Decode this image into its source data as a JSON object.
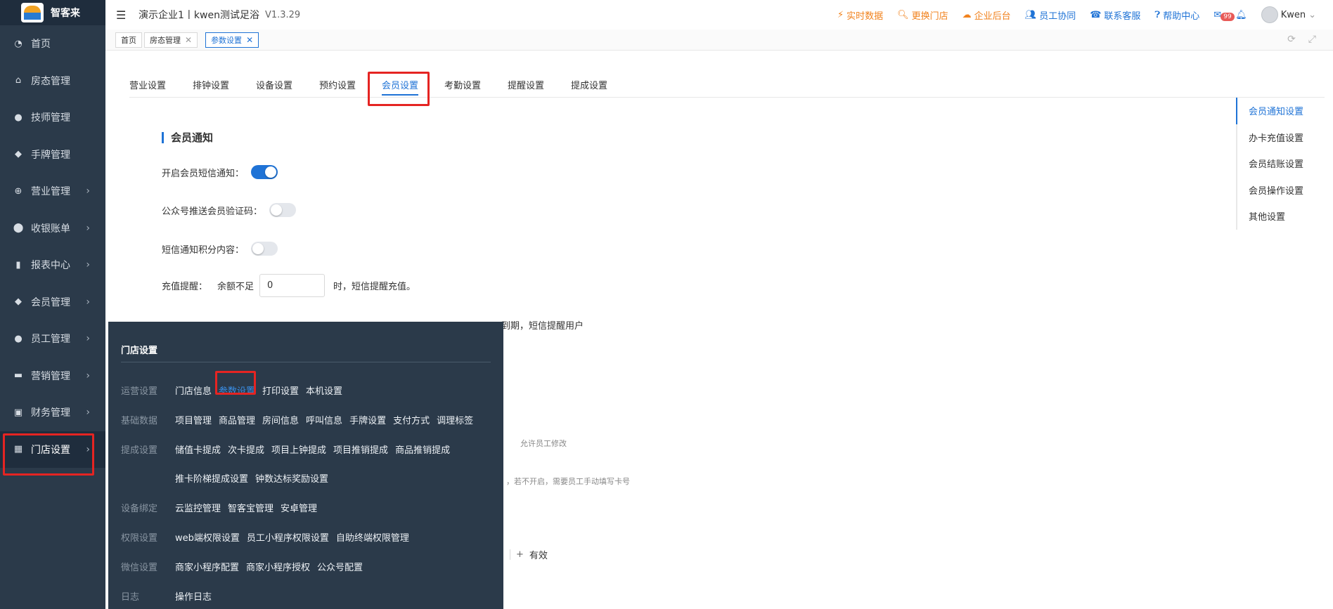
{
  "app": {
    "name": "智客来"
  },
  "sidebar": {
    "items": [
      {
        "label": "首页",
        "icon": "dashboard-icon",
        "has_children": false
      },
      {
        "label": "房态管理",
        "icon": "home-icon",
        "has_children": false
      },
      {
        "label": "技师管理",
        "icon": "user-icon",
        "has_children": false
      },
      {
        "label": "手牌管理",
        "icon": "tag-icon",
        "has_children": false
      },
      {
        "label": "营业管理",
        "icon": "target-icon",
        "has_children": true
      },
      {
        "label": "收银账单",
        "icon": "moneybag-icon",
        "has_children": true
      },
      {
        "label": "报表中心",
        "icon": "bar-chart-icon",
        "has_children": true
      },
      {
        "label": "会员管理",
        "icon": "diamond-icon",
        "has_children": true
      },
      {
        "label": "员工管理",
        "icon": "user-icon",
        "has_children": true
      },
      {
        "label": "营销管理",
        "icon": "briefcase-icon",
        "has_children": true
      },
      {
        "label": "财务管理",
        "icon": "wallet-icon",
        "has_children": true
      },
      {
        "label": "门店设置",
        "icon": "grid-icon",
        "has_children": true,
        "active": true
      }
    ]
  },
  "header": {
    "company": "演示企业1丨kwen测试足浴",
    "version": "V1.3.29",
    "links": [
      {
        "label": "实时数据",
        "icon": "trend-icon",
        "color": "#f1821d"
      },
      {
        "label": "更换门店",
        "icon": "search-icon",
        "color": "#f1821d"
      },
      {
        "label": "企业后台",
        "icon": "cloud-icon",
        "color": "#f1821d"
      },
      {
        "label": "员工协同",
        "icon": "users-icon",
        "color": "#1f73d6"
      },
      {
        "label": "联系客服",
        "icon": "phone-icon",
        "color": "#1f73d6"
      },
      {
        "label": "帮助中心",
        "icon": "help-icon",
        "color": "#1f73d6"
      }
    ],
    "mail_badge": "99",
    "user": "Kwen"
  },
  "tabs_strip": [
    {
      "label": "首页",
      "closable": false
    },
    {
      "label": "房态管理",
      "closable": true
    },
    {
      "label": "参数设置",
      "closable": true,
      "current": true
    }
  ],
  "settings_tabs": [
    "营业设置",
    "排钟设置",
    "设备设置",
    "预约设置",
    "会员设置",
    "考勤设置",
    "提醒设置",
    "提成设置"
  ],
  "settings_active": "会员设置",
  "section": {
    "title": "会员通知",
    "sms_notify_label": "开启会员短信通知：",
    "sms_notify_on": true,
    "wechat_code_label": "公众号推送会员验证码：",
    "wechat_code_on": false,
    "sms_points_label": "短信通知积分内容：",
    "sms_points_on": false,
    "recharge_label": "充值提醒：",
    "recharge_prefix": "余额不足",
    "recharge_value": "0",
    "recharge_suffix": "时，短信提醒充值。",
    "expire_partial": "天到期，短信提醒用户",
    "note_allow_edit": "允许员工修改",
    "note_card": "，若不开启，需要员工手动填写卡号",
    "valid_suffix": "有效"
  },
  "anchor": [
    "会员通知设置",
    "办卡充值设置",
    "会员结账设置",
    "会员操作设置",
    "其他设置"
  ],
  "flyout": {
    "title": "门店设置",
    "rows": [
      {
        "category": "运营设置",
        "links": [
          "门店信息",
          "参数设置",
          "打印设置",
          "本机设置"
        ],
        "active": "参数设置"
      },
      {
        "category": "基础数据",
        "links": [
          "项目管理",
          "商品管理",
          "房间信息",
          "呼叫信息",
          "手牌设置",
          "支付方式",
          "调理标签"
        ]
      },
      {
        "category": "提成设置",
        "links": [
          "储值卡提成",
          "次卡提成",
          "项目上钟提成",
          "项目推销提成",
          "商品推销提成"
        ]
      },
      {
        "category": "",
        "links": [
          "推卡阶梯提成设置",
          "钟数达标奖励设置"
        ]
      },
      {
        "category": "设备绑定",
        "links": [
          "云监控管理",
          "智客宝管理",
          "安卓管理"
        ]
      },
      {
        "category": "权限设置",
        "links": [
          "web端权限设置",
          "员工小程序权限设置",
          "自助终端权限管理"
        ]
      },
      {
        "category": "微信设置",
        "links": [
          "商家小程序配置",
          "商家小程序授权",
          "公众号配置"
        ]
      },
      {
        "category": "日志",
        "links": [
          "操作日志"
        ]
      }
    ]
  },
  "colors": {
    "accent": "#1f73d6",
    "sidebar": "#2b3a4a",
    "highlight": "#e52422"
  }
}
